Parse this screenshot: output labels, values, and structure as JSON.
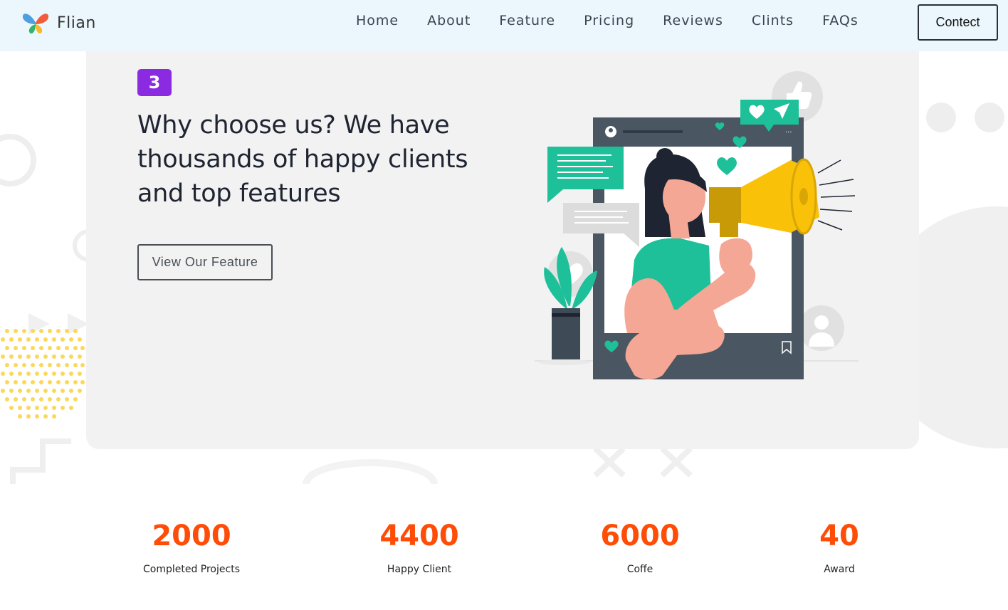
{
  "brand": {
    "name": "Flian"
  },
  "nav": {
    "items": [
      {
        "label": "Home"
      },
      {
        "label": "About"
      },
      {
        "label": "Feature"
      },
      {
        "label": "Pricing"
      },
      {
        "label": "Reviews"
      },
      {
        "label": "Clints"
      },
      {
        "label": "FAQs"
      }
    ],
    "contact_label": "Contect"
  },
  "hero": {
    "step_number": "3",
    "title": "Why choose us? We have thousands of happy clients and top features",
    "button_label": "View Our Feature",
    "illustration_icon": "woman-with-megaphone-illustration"
  },
  "stats": [
    {
      "value": "2000",
      "label": "Completed Projects"
    },
    {
      "value": "4400",
      "label": "Happy Client"
    },
    {
      "value": "6000",
      "label": "Coffe"
    },
    {
      "value": "40",
      "label": "Award"
    }
  ],
  "colors": {
    "header_bg": "#ebf7fd",
    "hero_bg": "#f2f2f2",
    "badge": "#8a2be2",
    "stat_accent": "#ff4c07",
    "illustration_teal": "#1ec09a",
    "illustration_yellow": "#f9c108"
  }
}
